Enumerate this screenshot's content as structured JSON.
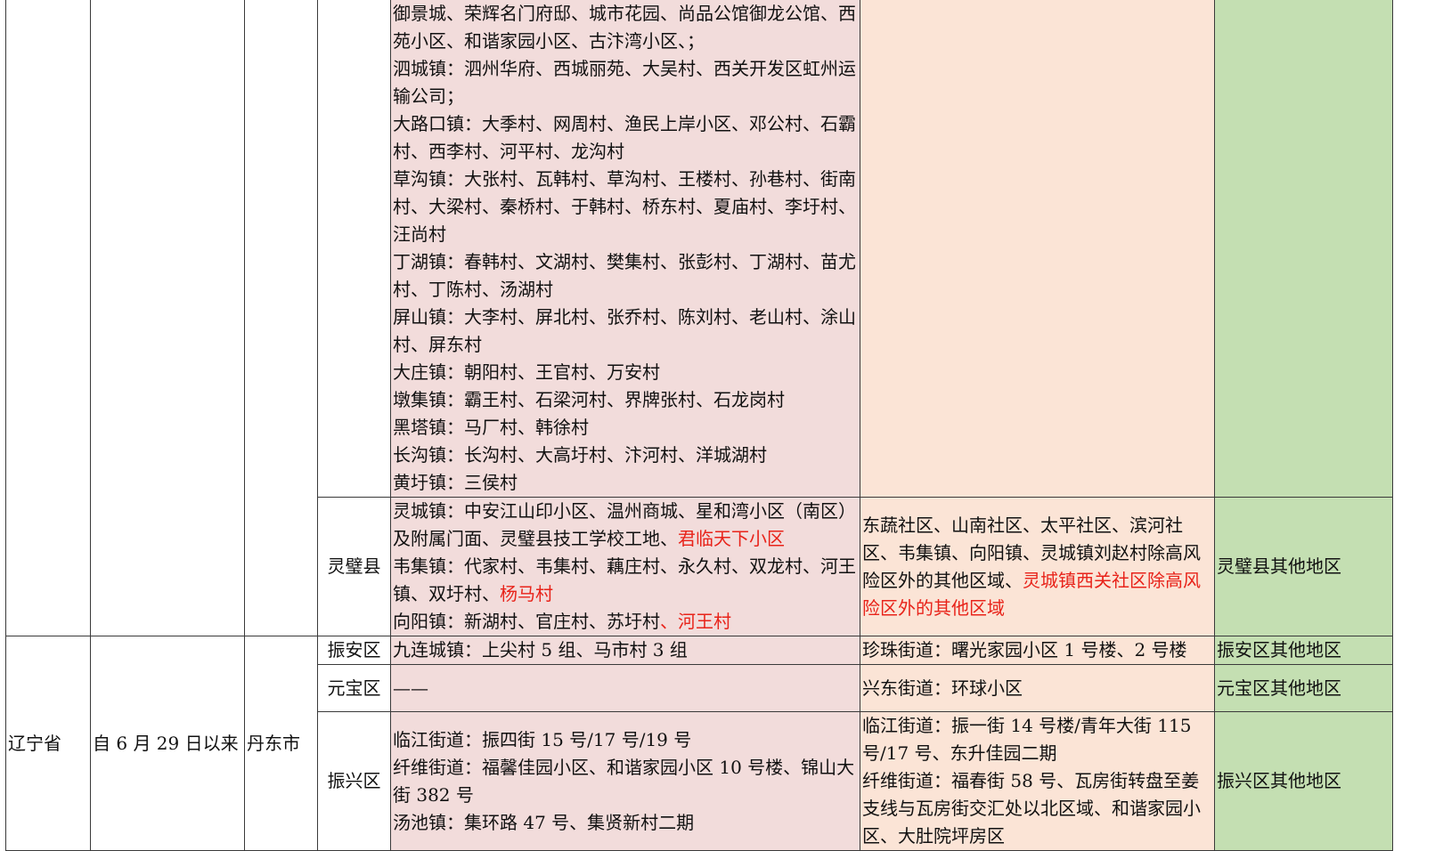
{
  "province": "辽宁省",
  "period": "自 6 月 29 日以来",
  "city": "丹东市",
  "top_block": {
    "mid_risk_lines": [
      "御景城、荣辉名门府邸、城市花园、尚品公馆御龙公馆、西苑小区、和谐家园小区、古汴湾小区、；",
      "泗城镇：泗州华府、西城丽苑、大吴村、西关开发区虹州运输公司；",
      "大路口镇：大季村、网周村、渔民上岸小区、邓公村、石霸村、西李村、河平村、龙沟村",
      "草沟镇：大张村、瓦韩村、草沟村、王楼村、孙巷村、街南村、大梁村、秦桥村、于韩村、桥东村、夏庙村、李圩村、汪尚村",
      "丁湖镇：春韩村、文湖村、樊集村、张彭村、丁湖村、苗尤村、丁陈村、汤湖村",
      "屏山镇：大李村、屏北村、张乔村、陈刘村、老山村、涂山村、屏东村",
      "大庄镇：朝阳村、王官村、万安村",
      "墩集镇：霸王村、石梁河村、界牌张村、石龙岗村",
      "黑塔镇：马厂村、韩徐村",
      "长沟镇：长沟村、大高圩村、汴河村、洋城湖村",
      "黄圩镇：三侯村"
    ]
  },
  "lingbi": {
    "district": "灵璧县",
    "mid_risk": {
      "line1": "灵城镇：中安江山印小区、温州商城、星和湾小区（南区）及附属门面、灵璧县技工学校工地、",
      "line1_red": "君临天下小区",
      "line2": "韦集镇：代家村、韦集村、藕庄村、永久村、双龙村、河王镇、双圩村、",
      "line2_red": "杨马村",
      "line3": "向阳镇：新湖村、官庄村、苏圩村",
      "line3_red": "、河王村"
    },
    "low_risk": {
      "text": "东蔬社区、山南社区、太平社区、滨河社区、韦集镇、向阳镇、灵城镇刘赵村除高风险区外的其他区域、",
      "text_red": "灵城镇西关社区除高风险区外的其他区域"
    },
    "normal": "灵璧县其他地区"
  },
  "dandong_rows": [
    {
      "district": "振安区",
      "mid_risk_lines": [
        "九连城镇：上尖村 5 组、马市村 3 组"
      ],
      "low_risk_lines": [
        "珍珠街道：曙光家园小区 1 号楼、2 号楼"
      ],
      "normal": "振安区其他地区"
    },
    {
      "district": "元宝区",
      "mid_risk_lines": [
        "——"
      ],
      "low_risk_lines": [
        "兴东街道：环球小区"
      ],
      "normal": "元宝区其他地区"
    },
    {
      "district": "振兴区",
      "mid_risk_lines": [
        "临江街道：振四街 15 号/17 号/19 号",
        "纤维街道：福馨佳园小区、和谐家园小区 10 号楼、锦山大街 382 号",
        "汤池镇：集环路 47 号、集贤新村二期"
      ],
      "low_risk_lines": [
        "临江街道：振一街 14 号楼/青年大街 115 号/17 号、东升佳园二期",
        "纤维街道：福春街 58 号、瓦房街转盘至姜支线与瓦房街交汇处以北区域、和谐家园小区、大肚院坪房区"
      ],
      "normal": "振兴区其他地区"
    }
  ],
  "colors": {
    "mid_risk_bg": "#f2dcdb",
    "low_risk_bg": "#fbe4d6",
    "normal_bg": "#c4dfb2",
    "highlight_red": "#e8231a"
  }
}
